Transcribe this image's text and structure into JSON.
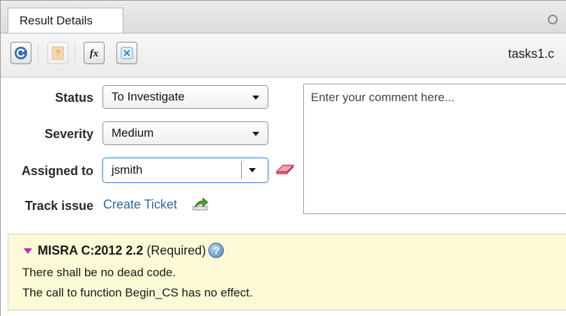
{
  "tab": {
    "label": "Result Details"
  },
  "toolbar": {
    "buttons": [
      {
        "icon": "refresh-icon",
        "enabled": true
      },
      {
        "icon": "help-book-icon",
        "enabled": false
      },
      {
        "icon": "function-fx-icon",
        "enabled": true
      },
      {
        "icon": "close-x-icon",
        "enabled": true
      }
    ],
    "filename": "tasks1.c"
  },
  "form": {
    "status_label": "Status",
    "status_value": "To Investigate",
    "severity_label": "Severity",
    "severity_value": "Medium",
    "assigned_label": "Assigned to",
    "assigned_value": "jsmith",
    "track_label": "Track issue",
    "track_link": "Create Ticket",
    "comment_placeholder": "Enter your comment here..."
  },
  "rule": {
    "name": "MISRA C:2012 2.2",
    "category": "(Required)",
    "help_glyph": "?",
    "lines": [
      "There shall be no dead code.",
      "The call to function Begin_CS has no effect."
    ]
  },
  "colors": {
    "link": "#2d6aa8",
    "info_background": "#fbf9d6",
    "rule_marker": "#c02fa3",
    "focus_border": "#4f93d6"
  }
}
